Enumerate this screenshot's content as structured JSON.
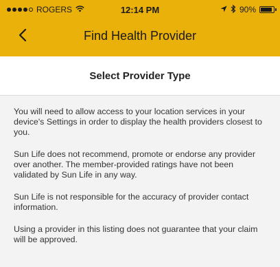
{
  "status_bar": {
    "carrier": "ROGERS",
    "time": "12:14 PM",
    "battery_percent": "90%",
    "signal_dots_filled": 4,
    "battery_level": 0.9
  },
  "nav": {
    "title": "Find Health Provider",
    "back_icon": "chevron-left-icon"
  },
  "subheader": {
    "title": "Select Provider Type"
  },
  "disclaimers": [
    "You will need to allow access to your location services in your device's Settings in order to display the health providers closest to you.",
    "Sun Life does not recommend, promote or endorse any provider over another. The member-provided ratings have not been validated by Sun Life in any way.",
    "Sun Life is not responsible for the accuracy of provider contact information.",
    "Using a provider in this listing does not guarantee that your claim will be approved."
  ],
  "colors": {
    "header_bg": "#e9b10a",
    "content_bg": "#f3f3f3"
  }
}
